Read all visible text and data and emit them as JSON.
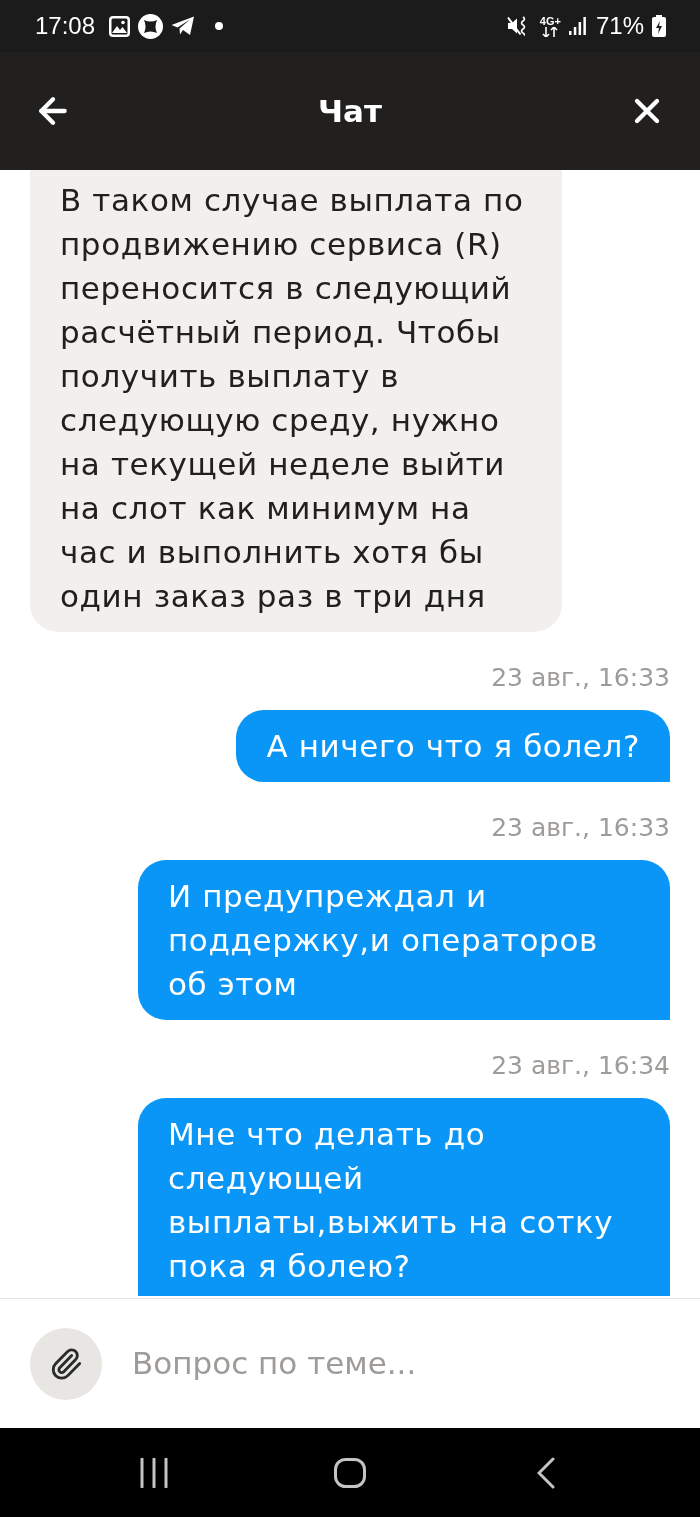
{
  "status_bar": {
    "time": "17:08",
    "network_type": "4G+",
    "battery": "71%"
  },
  "header": {
    "title": "Чат"
  },
  "messages": [
    {
      "kind": "incoming",
      "text": "В таком случае выплата по продвижению сервиса (R) переносится в следующий расчётный период. Чтобы получить выплату в следующую среду, нужно на текущей неделе выйти на слот как минимум на час и выполнить хотя бы один заказ раз в три дня"
    },
    {
      "kind": "outgoing",
      "time": "23 авг., 16:33",
      "text": "А ничего что я болел?"
    },
    {
      "kind": "outgoing",
      "time": "23 авг., 16:33",
      "text": "И предупреждал и поддержку,и операторов об этом"
    },
    {
      "kind": "outgoing",
      "time": "23 авг., 16:34",
      "text": "Мне что делать до следующей выплаты,выжить на сотку пока я болею?"
    }
  ],
  "composer": {
    "placeholder": "Вопрос по теме..."
  }
}
